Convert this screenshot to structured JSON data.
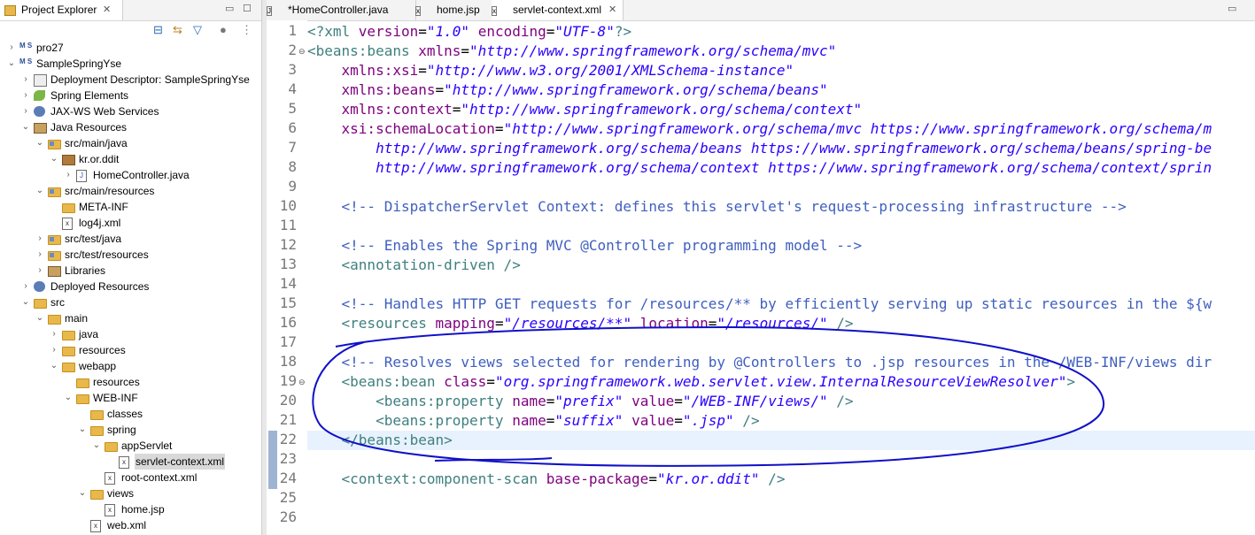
{
  "explorer": {
    "title": "Project Explorer",
    "tree": [
      {
        "label": "pro27",
        "depth": 0,
        "icon": "project-icon",
        "expanded": false,
        "sel": false
      },
      {
        "label": "SampleSpringYse",
        "depth": 0,
        "icon": "project-icon",
        "expanded": true,
        "sel": false
      },
      {
        "label": "Deployment Descriptor: SampleSpringYse",
        "depth": 1,
        "icon": "descriptor-icon",
        "expanded": false,
        "sel": false
      },
      {
        "label": "Spring Elements",
        "depth": 1,
        "icon": "spring-icon",
        "expanded": false,
        "sel": false
      },
      {
        "label": "JAX-WS Web Services",
        "depth": 1,
        "icon": "webservice-icon",
        "expanded": false,
        "sel": false
      },
      {
        "label": "Java Resources",
        "depth": 1,
        "icon": "java-resources-icon",
        "expanded": true,
        "sel": false
      },
      {
        "label": "src/main/java",
        "depth": 2,
        "icon": "source-folder-icon",
        "expanded": true,
        "sel": false
      },
      {
        "label": "kr.or.ddit",
        "depth": 3,
        "icon": "package-icon",
        "expanded": true,
        "sel": false
      },
      {
        "label": "HomeController.java",
        "depth": 4,
        "icon": "java-file-icon",
        "expanded": false,
        "sel": false
      },
      {
        "label": "src/main/resources",
        "depth": 2,
        "icon": "source-folder-icon",
        "expanded": true,
        "sel": false
      },
      {
        "label": "META-INF",
        "depth": 3,
        "icon": "folder-icon",
        "expanded": null,
        "sel": false
      },
      {
        "label": "log4j.xml",
        "depth": 3,
        "icon": "xml-file-icon",
        "expanded": null,
        "sel": false
      },
      {
        "label": "src/test/java",
        "depth": 2,
        "icon": "source-folder-icon",
        "expanded": false,
        "sel": false
      },
      {
        "label": "src/test/resources",
        "depth": 2,
        "icon": "source-folder-icon",
        "expanded": false,
        "sel": false
      },
      {
        "label": "Libraries",
        "depth": 2,
        "icon": "library-icon",
        "expanded": false,
        "sel": false
      },
      {
        "label": "Deployed Resources",
        "depth": 1,
        "icon": "deployed-icon",
        "expanded": false,
        "sel": false
      },
      {
        "label": "src",
        "depth": 1,
        "icon": "folder-icon",
        "expanded": true,
        "sel": false
      },
      {
        "label": "main",
        "depth": 2,
        "icon": "folder-icon",
        "expanded": true,
        "sel": false
      },
      {
        "label": "java",
        "depth": 3,
        "icon": "folder-icon",
        "expanded": false,
        "sel": false
      },
      {
        "label": "resources",
        "depth": 3,
        "icon": "folder-icon",
        "expanded": false,
        "sel": false
      },
      {
        "label": "webapp",
        "depth": 3,
        "icon": "folder-icon",
        "expanded": true,
        "sel": false
      },
      {
        "label": "resources",
        "depth": 4,
        "icon": "folder-icon",
        "expanded": null,
        "sel": false
      },
      {
        "label": "WEB-INF",
        "depth": 4,
        "icon": "folder-icon",
        "expanded": true,
        "sel": false
      },
      {
        "label": "classes",
        "depth": 5,
        "icon": "folder-icon",
        "expanded": null,
        "sel": false
      },
      {
        "label": "spring",
        "depth": 5,
        "icon": "folder-icon",
        "expanded": true,
        "sel": false
      },
      {
        "label": "appServlet",
        "depth": 6,
        "icon": "folder-icon",
        "expanded": true,
        "sel": false
      },
      {
        "label": "servlet-context.xml",
        "depth": 7,
        "icon": "xml-file-icon",
        "expanded": null,
        "sel": true
      },
      {
        "label": "root-context.xml",
        "depth": 6,
        "icon": "xml-file-icon",
        "expanded": null,
        "sel": false
      },
      {
        "label": "views",
        "depth": 5,
        "icon": "folder-icon",
        "expanded": true,
        "sel": false
      },
      {
        "label": "home.jsp",
        "depth": 6,
        "icon": "jsp-file-icon",
        "expanded": null,
        "sel": false
      },
      {
        "label": "web.xml",
        "depth": 5,
        "icon": "xml-file-icon",
        "expanded": null,
        "sel": false
      }
    ]
  },
  "editor": {
    "tabs": [
      {
        "label": "*HomeController.java",
        "active": false
      },
      {
        "label": "home.jsp",
        "active": false
      },
      {
        "label": "servlet-context.xml",
        "active": true
      }
    ],
    "current_line": 22,
    "lines": [
      {
        "n": "1",
        "fold": false,
        "segs": [
          [
            "t",
            "<?xml "
          ],
          [
            "a",
            "version"
          ],
          [
            "p",
            "="
          ],
          [
            "v",
            "\"1.0\""
          ],
          [
            "p",
            " "
          ],
          [
            "a",
            "encoding"
          ],
          [
            "p",
            "="
          ],
          [
            "v",
            "\"UTF-8\""
          ],
          [
            "t",
            "?>"
          ]
        ]
      },
      {
        "n": "2",
        "fold": true,
        "segs": [
          [
            "t",
            "<beans:beans "
          ],
          [
            "a",
            "xmlns"
          ],
          [
            "p",
            "="
          ],
          [
            "v",
            "\"http://www.springframework.org/schema/mvc\""
          ]
        ]
      },
      {
        "n": "3",
        "fold": false,
        "segs": [
          [
            "p",
            "    "
          ],
          [
            "a",
            "xmlns:xsi"
          ],
          [
            "p",
            "="
          ],
          [
            "v",
            "\"http://www.w3.org/2001/XMLSchema-instance\""
          ]
        ]
      },
      {
        "n": "4",
        "fold": false,
        "segs": [
          [
            "p",
            "    "
          ],
          [
            "a",
            "xmlns:beans"
          ],
          [
            "p",
            "="
          ],
          [
            "v",
            "\"http://www.springframework.org/schema/beans\""
          ]
        ]
      },
      {
        "n": "5",
        "fold": false,
        "segs": [
          [
            "p",
            "    "
          ],
          [
            "a",
            "xmlns:context"
          ],
          [
            "p",
            "="
          ],
          [
            "v",
            "\"http://www.springframework.org/schema/context\""
          ]
        ]
      },
      {
        "n": "6",
        "fold": false,
        "segs": [
          [
            "p",
            "    "
          ],
          [
            "a",
            "xsi:schemaLocation"
          ],
          [
            "p",
            "="
          ],
          [
            "v",
            "\"http://www.springframework.org/schema/mvc https://www.springframework.org/schema/m"
          ]
        ]
      },
      {
        "n": "7",
        "fold": false,
        "segs": [
          [
            "p",
            "        "
          ],
          [
            "v",
            "http://www.springframework.org/schema/beans https://www.springframework.org/schema/beans/spring-be"
          ]
        ]
      },
      {
        "n": "8",
        "fold": false,
        "segs": [
          [
            "p",
            "        "
          ],
          [
            "v",
            "http://www.springframework.org/schema/context https://www.springframework.org/schema/context/sprin"
          ]
        ]
      },
      {
        "n": "9",
        "fold": false,
        "segs": []
      },
      {
        "n": "10",
        "fold": false,
        "segs": [
          [
            "p",
            "    "
          ],
          [
            "c",
            "<!-- DispatcherServlet Context: defines this servlet's request-processing infrastructure -->"
          ]
        ]
      },
      {
        "n": "11",
        "fold": false,
        "segs": []
      },
      {
        "n": "12",
        "fold": false,
        "segs": [
          [
            "p",
            "    "
          ],
          [
            "c",
            "<!-- Enables the Spring MVC @Controller programming model -->"
          ]
        ]
      },
      {
        "n": "13",
        "fold": false,
        "segs": [
          [
            "p",
            "    "
          ],
          [
            "t",
            "<annotation-driven />"
          ]
        ]
      },
      {
        "n": "14",
        "fold": false,
        "segs": []
      },
      {
        "n": "15",
        "fold": false,
        "segs": [
          [
            "p",
            "    "
          ],
          [
            "c",
            "<!-- Handles HTTP GET requests for /resources/** by efficiently serving up static resources in the ${w"
          ]
        ]
      },
      {
        "n": "16",
        "fold": false,
        "segs": [
          [
            "p",
            "    "
          ],
          [
            "t",
            "<resources "
          ],
          [
            "a",
            "mapping"
          ],
          [
            "p",
            "="
          ],
          [
            "v",
            "\"/resources/**\""
          ],
          [
            "p",
            " "
          ],
          [
            "a",
            "location"
          ],
          [
            "p",
            "="
          ],
          [
            "v",
            "\"/resources/\""
          ],
          [
            "t",
            " />"
          ]
        ]
      },
      {
        "n": "17",
        "fold": false,
        "segs": []
      },
      {
        "n": "18",
        "fold": false,
        "segs": [
          [
            "p",
            "    "
          ],
          [
            "c",
            "<!-- Resolves views selected for rendering by @Controllers to .jsp resources in the /WEB-INF/views dir"
          ]
        ]
      },
      {
        "n": "19",
        "fold": true,
        "segs": [
          [
            "p",
            "    "
          ],
          [
            "t",
            "<beans:bean "
          ],
          [
            "a",
            "class"
          ],
          [
            "p",
            "="
          ],
          [
            "v",
            "\"org.springframework.web.servlet.view.InternalResourceViewResolver\""
          ],
          [
            "t",
            ">"
          ]
        ]
      },
      {
        "n": "20",
        "fold": false,
        "segs": [
          [
            "p",
            "        "
          ],
          [
            "t",
            "<beans:property "
          ],
          [
            "a",
            "name"
          ],
          [
            "p",
            "="
          ],
          [
            "v",
            "\"prefix\""
          ],
          [
            "p",
            " "
          ],
          [
            "a",
            "value"
          ],
          [
            "p",
            "="
          ],
          [
            "v",
            "\"/WEB-INF/views/\""
          ],
          [
            "t",
            " />"
          ]
        ]
      },
      {
        "n": "21",
        "fold": false,
        "segs": [
          [
            "p",
            "        "
          ],
          [
            "t",
            "<beans:property "
          ],
          [
            "a",
            "name"
          ],
          [
            "p",
            "="
          ],
          [
            "v",
            "\"suffix\""
          ],
          [
            "p",
            " "
          ],
          [
            "a",
            "value"
          ],
          [
            "p",
            "="
          ],
          [
            "v",
            "\".jsp\""
          ],
          [
            "t",
            " />"
          ]
        ]
      },
      {
        "n": "22",
        "fold": false,
        "segs": [
          [
            "p",
            "    "
          ],
          [
            "t",
            "</beans:bean>"
          ]
        ]
      },
      {
        "n": "23",
        "fold": false,
        "segs": []
      },
      {
        "n": "24",
        "fold": false,
        "segs": [
          [
            "p",
            "    "
          ],
          [
            "t",
            "<context:component-scan "
          ],
          [
            "a",
            "base-package"
          ],
          [
            "p",
            "="
          ],
          [
            "v",
            "\"kr.or.ddit\""
          ],
          [
            "t",
            " />"
          ]
        ]
      },
      {
        "n": "25",
        "fold": false,
        "segs": []
      },
      {
        "n": "26",
        "fold": false,
        "segs": []
      }
    ]
  },
  "colors": {
    "tag": "#3f7f7f",
    "attribute": "#7f007f",
    "value": "#2a00ff",
    "comment": "#3f5fbf",
    "annotation_ink": "#1010c8",
    "current_line": "#e8f2fe",
    "selection": "#d9d9d9"
  }
}
